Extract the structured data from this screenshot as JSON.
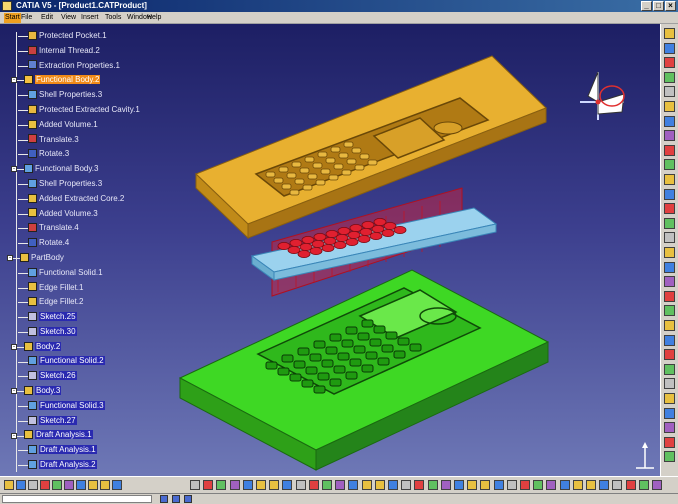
{
  "window": {
    "title": "CATIA V5 - [Product1.CATProduct]",
    "controls": [
      "_",
      "□",
      "×"
    ]
  },
  "menu": {
    "items": [
      "Start",
      "File",
      "Edit",
      "View",
      "Insert",
      "Tools",
      "Window",
      "Help"
    ]
  },
  "tree": {
    "nodes": [
      {
        "label": "Protected Pocket.1",
        "icon": "pad-icon",
        "color": "#e8b840"
      },
      {
        "label": "Internal Thread.2",
        "icon": "thread-icon",
        "color": "#c84040"
      },
      {
        "label": "Extraction Properties.1",
        "icon": "properties-icon",
        "color": "#6080d0"
      },
      {
        "label": "Functional Body.2",
        "icon": "functional-body-icon",
        "color": "#f5c040",
        "highlight": true
      },
      {
        "label": "Shell Properties.3",
        "icon": "shell-icon",
        "color": "#60a0e0"
      },
      {
        "label": "Protected Extracted Cavity.1",
        "icon": "cavity-icon",
        "color": "#e8b840"
      },
      {
        "label": "Added Volume.1",
        "icon": "volume-icon",
        "color": "#e8c040"
      },
      {
        "label": "Translate.3",
        "icon": "translate-icon",
        "color": "#d04040"
      },
      {
        "label": "Rotate.3",
        "icon": "rotate-icon",
        "color": "#4060c0"
      },
      {
        "label": "Functional Body.3",
        "icon": "functional-body-icon",
        "color": "#60a0e0"
      },
      {
        "label": "Shell Properties.3",
        "icon": "shell-icon",
        "color": "#60a0e0"
      },
      {
        "label": "Added Extracted Core.2",
        "icon": "core-icon",
        "color": "#e8c040"
      },
      {
        "label": "Added Volume.3",
        "icon": "volume-icon",
        "color": "#e8c040"
      },
      {
        "label": "Translate.4",
        "icon": "translate-icon",
        "color": "#d04040"
      },
      {
        "label": "Rotate.4",
        "icon": "rotate-icon",
        "color": "#4060c0"
      },
      {
        "label": "PartBody",
        "icon": "partbody-icon",
        "color": "#e8c040"
      },
      {
        "label": "Functional Solid.1",
        "icon": "solid-icon",
        "color": "#60a0e0"
      },
      {
        "label": "Edge Fillet.1",
        "icon": "edge-fillet-icon",
        "color": "#e8c040"
      },
      {
        "label": "Edge Fillet.2",
        "icon": "edge-fillet-icon",
        "color": "#e8c040"
      },
      {
        "label": "Sketch.25",
        "icon": "sketch-icon",
        "color": "#c0c0e0",
        "selected": true
      },
      {
        "label": "Sketch.30",
        "icon": "sketch-icon",
        "color": "#c0c0e0",
        "selected": true
      },
      {
        "label": "Body.2",
        "icon": "body-icon",
        "color": "#e8c040",
        "selected": true
      },
      {
        "label": "Functional Solid.2",
        "icon": "solid-icon",
        "color": "#60a0e0",
        "selected": true
      },
      {
        "label": "Sketch.26",
        "icon": "sketch-icon",
        "color": "#c0c0e0",
        "selected": true
      },
      {
        "label": "Body.3",
        "icon": "body-icon",
        "color": "#e8c040",
        "selected": true
      },
      {
        "label": "Functional Solid.3",
        "icon": "solid-icon",
        "color": "#60a0e0",
        "selected": true
      },
      {
        "label": "Sketch.27",
        "icon": "sketch-icon",
        "color": "#c0c0e0",
        "selected": true
      },
      {
        "label": "Draft Analysis.1",
        "icon": "analysis-icon",
        "color": "#e8c040",
        "selected": true
      },
      {
        "label": "Draft Analysis.1",
        "icon": "analysis-icon",
        "color": "#60a0e0",
        "selected": true
      },
      {
        "label": "Draft Analysis.2",
        "icon": "analysis-icon",
        "color": "#60a0e0",
        "selected": true
      }
    ]
  },
  "status": {
    "text": ""
  },
  "colors": {
    "viewport_top": "#1d1f64",
    "viewport_bottom": "#6e78b6",
    "cavity_mold": "#e8b030",
    "core_mold": "#3ed824",
    "phone_shell": "#9bd2ee",
    "keys": "#e02030",
    "highlight": "#f08a18",
    "selection": "#2a2ab0"
  },
  "icons": {
    "compass": "compass-icon",
    "axis": "axis-icon"
  }
}
